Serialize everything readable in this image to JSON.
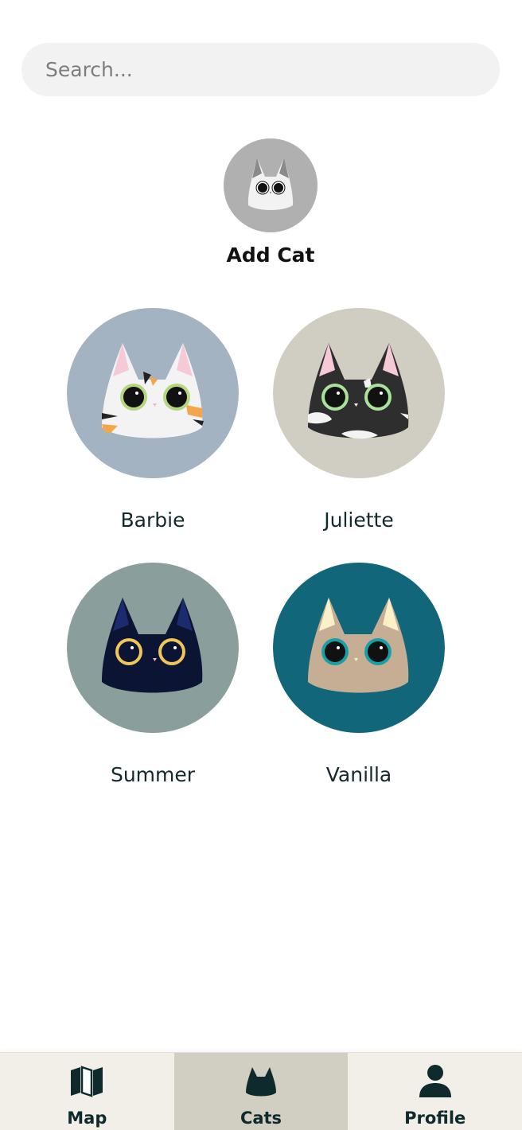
{
  "search": {
    "placeholder": "Search..."
  },
  "add_cat": {
    "label": "Add Cat",
    "color": "#b0b0b0"
  },
  "cats": [
    {
      "name": "Barbie",
      "bg": "#a3b3c1"
    },
    {
      "name": "Juliette",
      "bg": "#d0cec2"
    },
    {
      "name": "Summer",
      "bg": "#8a9e9b"
    },
    {
      "name": "Vanilla",
      "bg": "#12667a"
    }
  ],
  "nav": {
    "items": [
      {
        "label": "Map",
        "icon": "map-icon"
      },
      {
        "label": "Cats",
        "icon": "cat-icon",
        "active": true
      },
      {
        "label": "Profile",
        "icon": "person-icon"
      }
    ],
    "active_color": "#d1cec2",
    "bar_color": "#f2efe8"
  }
}
